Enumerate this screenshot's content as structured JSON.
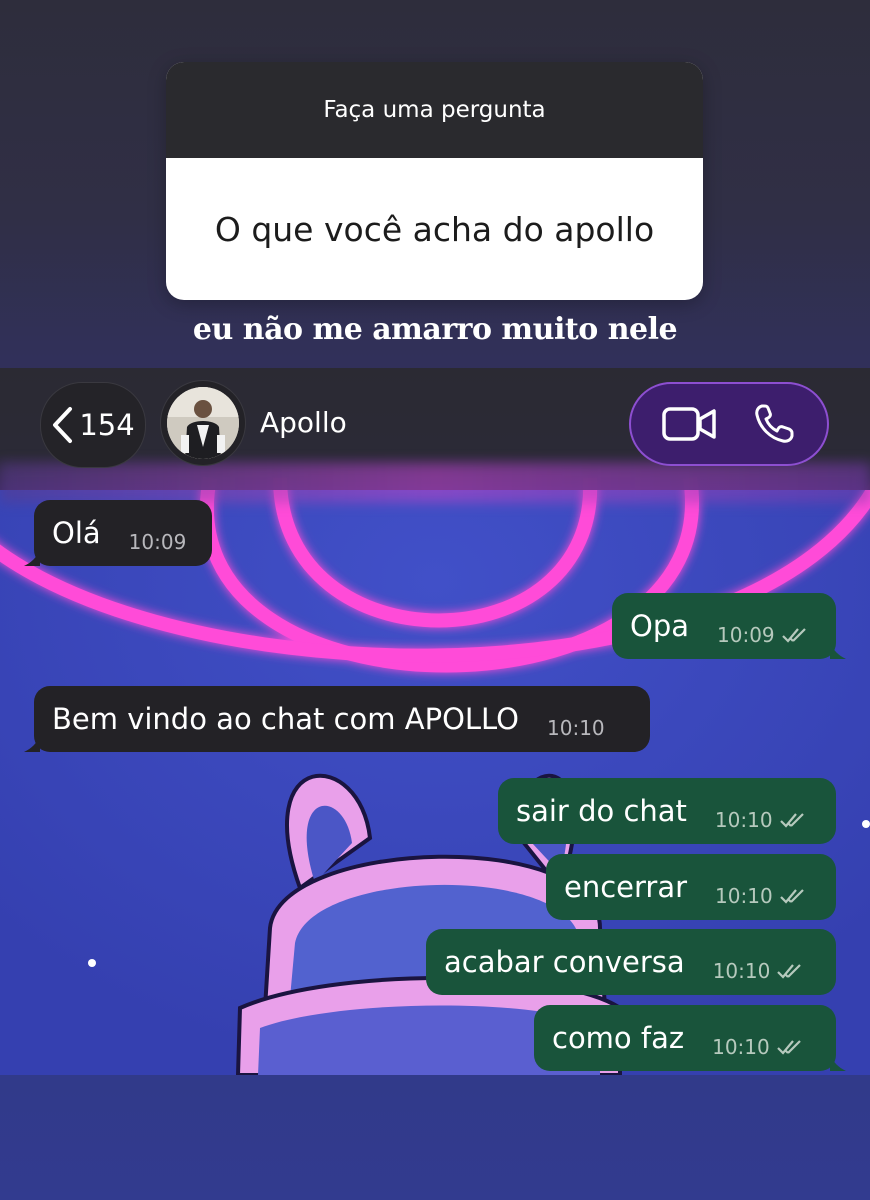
{
  "story": {
    "question_header": "Faça uma pergunta",
    "question_text": "O que você acha do apollo",
    "answer_caption": "eu não me amarro muito nele"
  },
  "chat_header": {
    "back_count": "154",
    "back_icon": "chevron-left-icon",
    "contact_name": "Apollo",
    "video_icon": "video-camera-icon",
    "phone_icon": "phone-icon"
  },
  "messages": [
    {
      "direction": "incoming",
      "text": "Olá",
      "time": "10:09"
    },
    {
      "direction": "outgoing",
      "text": "Opa",
      "time": "10:09"
    },
    {
      "direction": "incoming",
      "text": "Bem vindo ao chat com APOLLO",
      "time": "10:10"
    },
    {
      "direction": "outgoing",
      "text": "sair do chat",
      "time": "10:10"
    },
    {
      "direction": "outgoing",
      "text": "encerrar",
      "time": "10:10"
    },
    {
      "direction": "outgoing",
      "text": "acabar conversa",
      "time": "10:10"
    },
    {
      "direction": "outgoing",
      "text": "como faz",
      "time": "10:10"
    }
  ],
  "colors": {
    "incoming_bubble": "#232226",
    "outgoing_bubble": "#19543b",
    "wallpaper": "#3a47b8",
    "neon": "#ff4bd8",
    "call_pill": "#3d1e6d"
  }
}
